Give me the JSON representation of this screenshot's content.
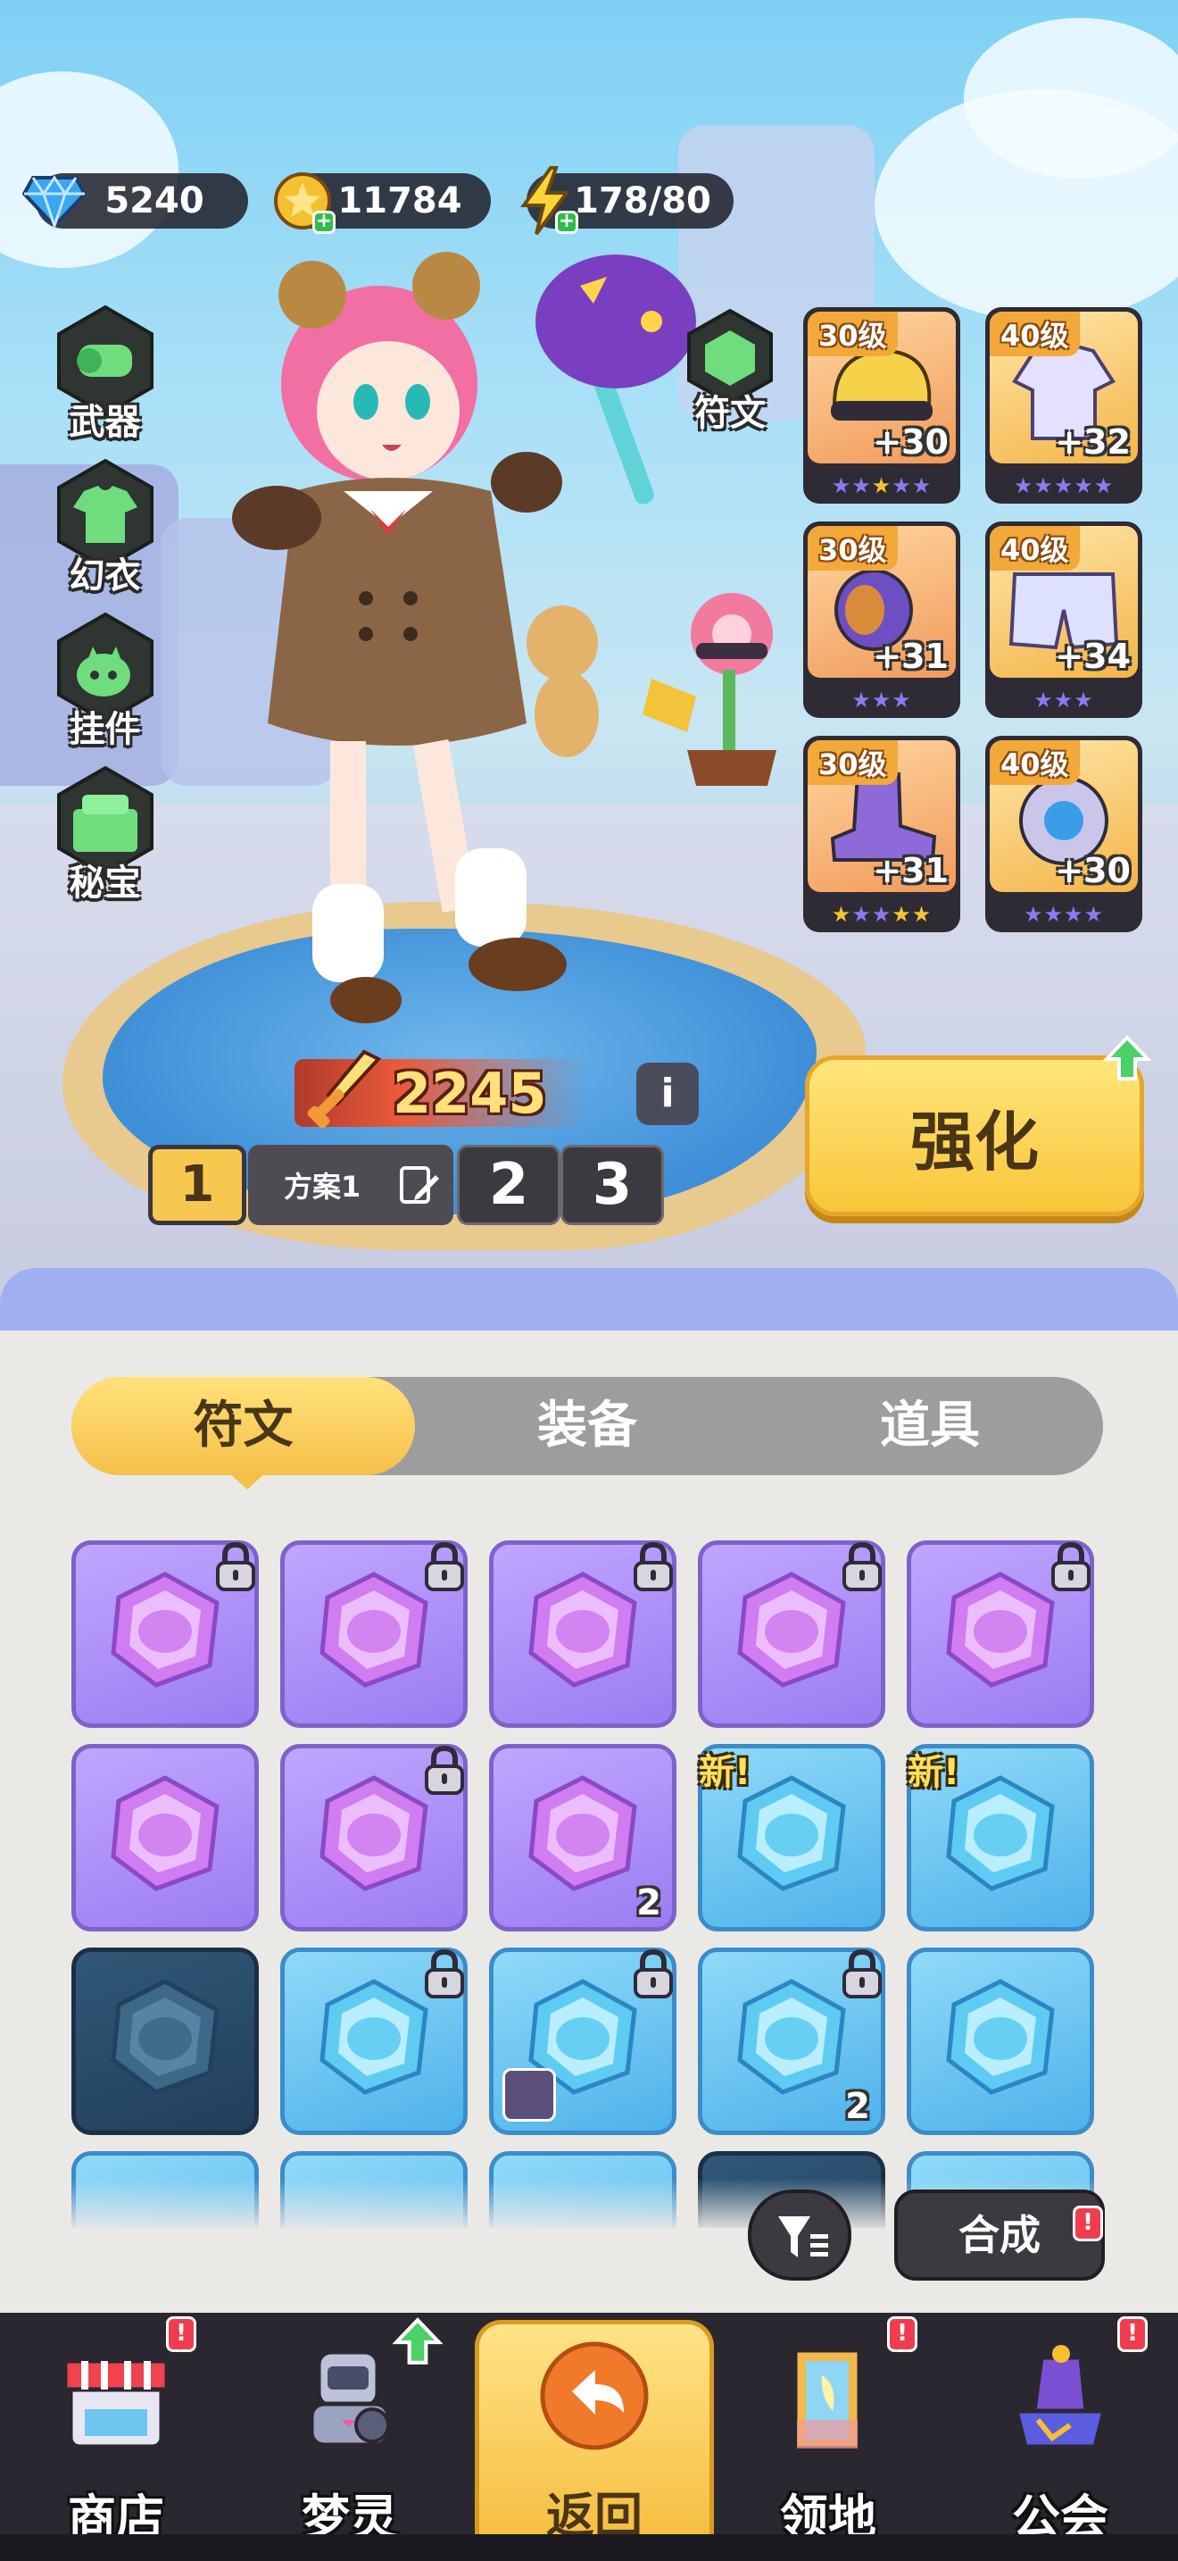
{
  "resources": {
    "diamonds": "5240",
    "gold": "11784",
    "energy": "178/80",
    "diamond_icon": "diamond-icon",
    "gold_icon": "gold-coin-icon",
    "energy_icon": "lightning-icon"
  },
  "left_menu": [
    {
      "label": "武器",
      "icon": "weapon-icon"
    },
    {
      "label": "幻衣",
      "icon": "outfit-icon"
    },
    {
      "label": "挂件",
      "icon": "pendant-icon"
    },
    {
      "label": "秘宝",
      "icon": "treasure-icon"
    }
  ],
  "rune_button": {
    "label": "符文",
    "icon": "rune-icon"
  },
  "equipment": [
    {
      "level": "30级",
      "plus": "+30",
      "stars": 5,
      "gold_stars": 1,
      "icon": "helmet-icon"
    },
    {
      "level": "40级",
      "plus": "+32",
      "stars": 5,
      "gold_stars": 0,
      "icon": "jacket-icon"
    },
    {
      "level": "30级",
      "plus": "+31",
      "stars": 3,
      "gold_stars": 0,
      "icon": "bracer-icon"
    },
    {
      "level": "40级",
      "plus": "+34",
      "stars": 3,
      "gold_stars": 0,
      "icon": "shorts-icon"
    },
    {
      "level": "30级",
      "plus": "+31",
      "stars": 5,
      "gold_stars": 3,
      "icon": "boots-icon"
    },
    {
      "level": "40级",
      "plus": "+30",
      "stars": 4,
      "gold_stars": 0,
      "icon": "gadget-icon"
    }
  ],
  "power": "2245",
  "info_label": "i",
  "plan": {
    "active": "1",
    "name": "方案1",
    "others": [
      "2",
      "3"
    ]
  },
  "enhance_label": "强化",
  "tabs": [
    {
      "label": "符文",
      "active": true
    },
    {
      "label": "装备",
      "active": false
    },
    {
      "label": "道具",
      "active": false
    }
  ],
  "runes": [
    {
      "color": "purple",
      "locked": true,
      "icon": "helmet-rune-icon"
    },
    {
      "color": "purple",
      "locked": true,
      "icon": "helmet-rune-icon"
    },
    {
      "color": "purple",
      "locked": true,
      "icon": "helmet-rune-icon"
    },
    {
      "color": "purple",
      "locked": true,
      "icon": "shoe-rune-icon"
    },
    {
      "color": "purple",
      "locked": true,
      "icon": "shoe-rune-icon"
    },
    {
      "color": "purple",
      "locked": false,
      "icon": "shoe-rune-icon"
    },
    {
      "color": "purple",
      "locked": true,
      "icon": "glove-rune-icon"
    },
    {
      "color": "purple",
      "locked": false,
      "icon": "glove-rune-icon",
      "count": "2"
    },
    {
      "color": "blue",
      "locked": false,
      "icon": "bracer-rune-icon",
      "new": "新!"
    },
    {
      "color": "blue",
      "locked": false,
      "icon": "shorts-rune-icon",
      "new": "新!"
    },
    {
      "color": "dark",
      "locked": false,
      "icon": "helmet-rune-icon"
    },
    {
      "color": "blue",
      "locked": true,
      "icon": "jacket-rune-icon"
    },
    {
      "color": "blue",
      "locked": true,
      "icon": "jacket-rune-icon",
      "equipped": true
    },
    {
      "color": "blue",
      "locked": true,
      "icon": "bracer-rune-icon",
      "count": "2"
    },
    {
      "color": "blue",
      "locked": false,
      "icon": "bracer-rune-icon"
    }
  ],
  "filter_icon": "filter-icon",
  "compose_label": "合成",
  "alert_mark": "!",
  "nav": [
    {
      "label": "商店",
      "icon": "shop-icon",
      "alert": true
    },
    {
      "label": "梦灵",
      "icon": "spirit-robot-icon",
      "upgrade": true
    },
    {
      "label": "返回",
      "icon": "return-icon",
      "active": true
    },
    {
      "label": "领地",
      "icon": "territory-door-icon",
      "alert": true
    },
    {
      "label": "公会",
      "icon": "guild-icon",
      "alert": true
    }
  ],
  "colors": {
    "accent_yellow": "#f8c53a",
    "dark_panel": "#3c3a40",
    "rune_purple": "#9b7cf1",
    "rune_blue": "#4fb2ea",
    "alert_red": "#f03d4d"
  }
}
